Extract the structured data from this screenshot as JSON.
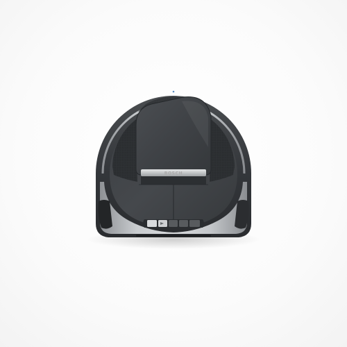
{
  "image": {
    "subject": "robot-vacuum-cleaner",
    "view": "top-down",
    "background_color": "#ffffff",
    "body_color": "#3a3d40",
    "accent_color": "#b9bcbf",
    "lid_color": "#404346"
  },
  "product": {
    "brand": "BOSCH"
  },
  "controls": {
    "buttons": [
      "",
      "",
      "",
      "",
      ""
    ]
  }
}
